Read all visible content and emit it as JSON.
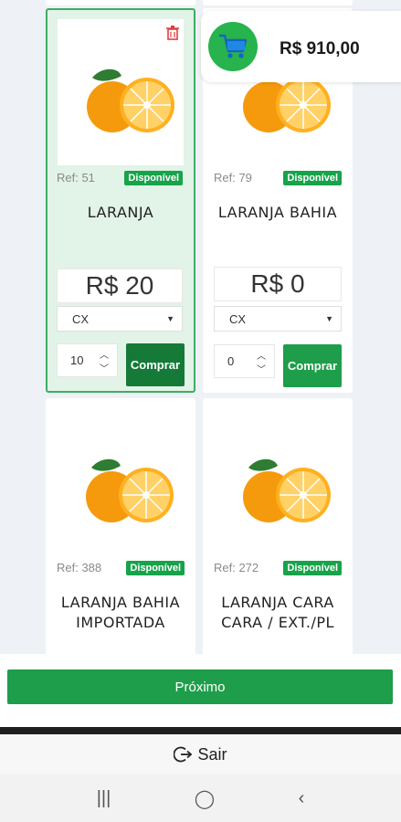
{
  "cart": {
    "total": "R$ 910,00",
    "icon": "shopping-cart-icon",
    "accent": "#27b34d"
  },
  "products": [
    {
      "ref": "Ref: 51",
      "status": "Disponível",
      "name": "LARANJA",
      "price": "R$ 20",
      "unit": "CX",
      "qty": "10",
      "buy_label": "Comprar",
      "selected": true
    },
    {
      "ref": "Ref: 79",
      "status": "Disponível",
      "name": "LARANJA BAHIA",
      "price": "R$ 0",
      "unit": "CX",
      "qty": "0",
      "buy_label": "Comprar",
      "selected": false
    },
    {
      "ref": "Ref: 388",
      "status": "Disponível",
      "name": "LARANJA BAHIA IMPORTADA",
      "selected": false
    },
    {
      "ref": "Ref: 272",
      "status": "Disponível",
      "name": "LARANJA CARA CARA / EXT./PL",
      "selected": false
    }
  ],
  "footer": {
    "next_label": "Próximo",
    "exit_label": "Sair"
  },
  "colors": {
    "primary": "#1e9e4a",
    "selected_bg": "#e2f3e8",
    "badge": "#17a34a"
  }
}
